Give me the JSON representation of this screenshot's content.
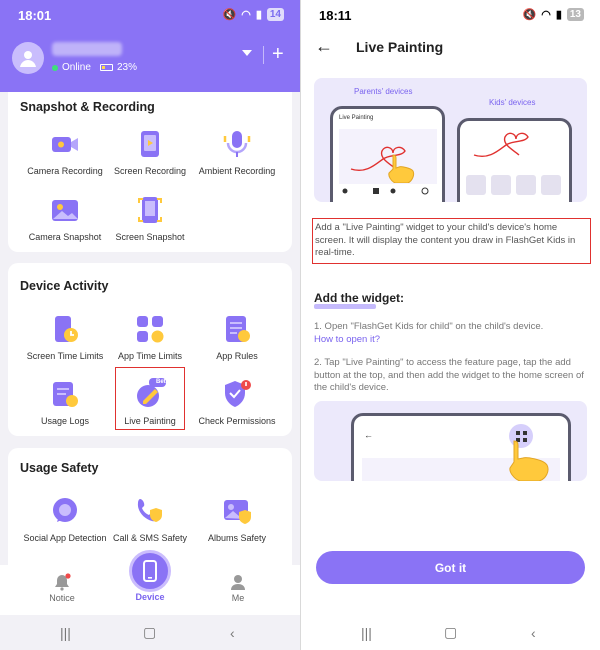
{
  "left": {
    "status": {
      "time": "18:01",
      "battery": "14"
    },
    "header": {
      "status_text": "Online",
      "battery": "23%"
    },
    "sections": [
      {
        "title": "Snapshot & Recording",
        "items": [
          "Camera Recording",
          "Screen Recording",
          "Ambient Recording",
          "Camera Snapshot",
          "Screen Snapshot"
        ]
      },
      {
        "title": "Device Activity",
        "items": [
          "Screen Time Limits",
          "App Time Limits",
          "App Rules",
          "Usage Logs",
          "Live Painting",
          "Check Permissions"
        ],
        "beta_label": "Beta"
      },
      {
        "title": "Usage Safety",
        "items": [
          "Social App Detection",
          "Call & SMS Safety",
          "Albums Safety"
        ]
      }
    ],
    "nav": {
      "notice": "Notice",
      "device": "Device",
      "me": "Me"
    }
  },
  "right": {
    "status": {
      "time": "18:11",
      "battery": "13"
    },
    "title": "Live Painting",
    "illustration": {
      "parents_label": "Parents' devices",
      "kids_label": "Kids' devices",
      "screen_title": "Live Painting"
    },
    "description": "Add a \"Live Painting\" widget to your child's device's home screen. It will display the content you draw in FlashGet Kids in real-time.",
    "subtitle": "Add the widget:",
    "step1": "1. Open \"FlashGet Kids for child\" on the child's device.",
    "step1_link": "How to open it?",
    "step2": "2. Tap \"Live Painting\" to access the feature page, tap the add button at the top, and then add the widget to the home screen of the child's device.",
    "button": "Got it"
  },
  "colors": {
    "primary": "#8a73f5",
    "highlight": "#e0312f",
    "accent_yellow": "#ffc93c"
  }
}
